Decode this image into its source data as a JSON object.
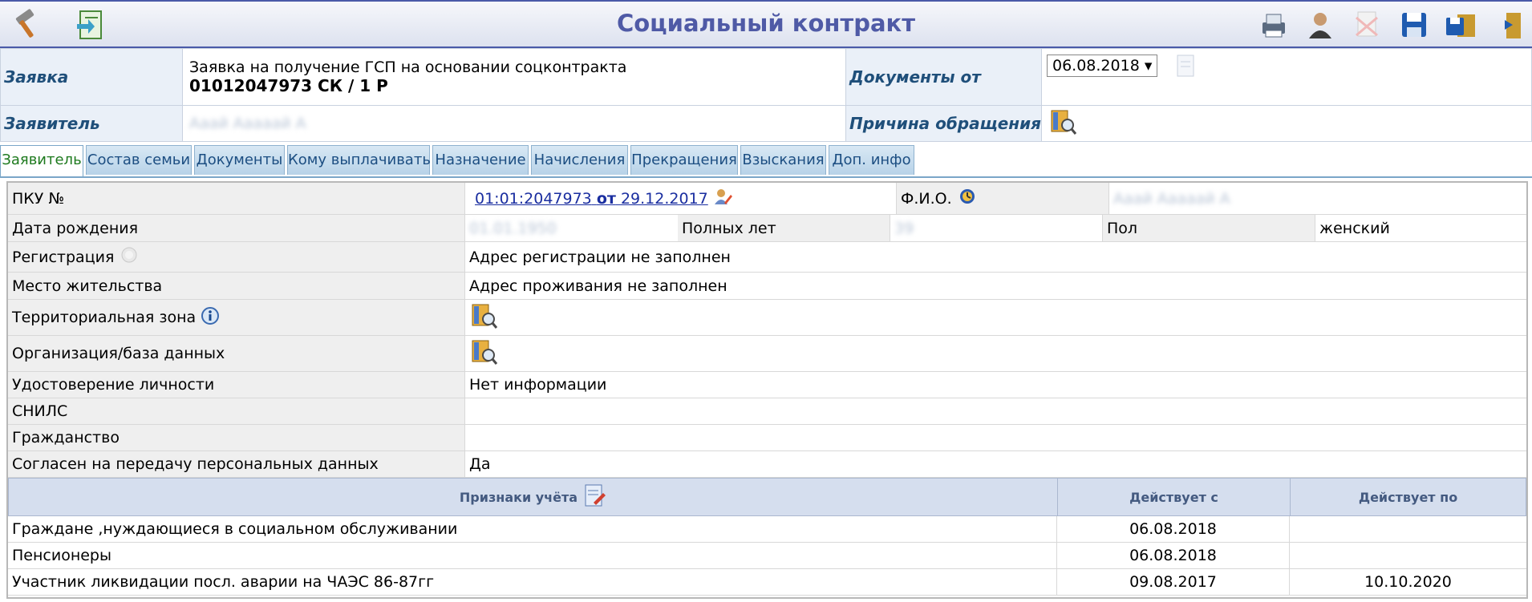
{
  "header": {
    "title": "Социальный контракт"
  },
  "request": {
    "label": "Заявка",
    "line1": "Заявка на получение ГСП на основании соцконтракта",
    "line2": "01012047973 СК / 1 Р",
    "docs_label": "Документы от",
    "docs_date": "06.08.2018",
    "applicant_label": "Заявитель",
    "applicant_value": "Ааай Ааааай А",
    "reason_label": "Причина обращения"
  },
  "tabs": [
    {
      "label": "Заявитель"
    },
    {
      "label": "Состав семьи"
    },
    {
      "label": "Документы"
    },
    {
      "label": "Кому выплачивать"
    },
    {
      "label": "Назначение"
    },
    {
      "label": "Начисления"
    },
    {
      "label": "Прекращения"
    },
    {
      "label": "Взыскания"
    },
    {
      "label": "Доп. инфо"
    }
  ],
  "details": {
    "pku_label": "ПКУ №",
    "pku_number": "01:01:2047973",
    "pku_from": "от",
    "pku_date": "29.12.2017",
    "fio_label": "Ф.И.О.",
    "fio_value": "Ааай Ааааай А",
    "birth_label": "Дата рождения",
    "birth_value": "01.01.1950",
    "age_label": "Полных лет",
    "age_value": "39",
    "sex_label": "Пол",
    "sex_value": "женский",
    "registration_label": "Регистрация",
    "registration_value": "Адрес регистрации не заполнен",
    "residence_label": "Место жительства",
    "residence_value": "Адрес проживания не заполнен",
    "zone_label": "Территориальная зона",
    "org_label": "Организация/база данных",
    "id_label": "Удостоверение личности",
    "id_value": "Нет информации",
    "snils_label": "СНИЛС",
    "citizenship_label": "Гражданство",
    "consent_label": "Согласен на передачу персональных данных",
    "consent_value": "Да"
  },
  "signs": {
    "col1": "Признаки учёта",
    "col2": "Действует с",
    "col3": "Действует по",
    "rows": [
      {
        "name": "Граждане ,нуждающиеся в социальном обслуживании",
        "from": "06.08.2018",
        "to": ""
      },
      {
        "name": "Пенсионеры",
        "from": "06.08.2018",
        "to": ""
      },
      {
        "name": "Участник ликвидации посл. аварии на ЧАЭС 86-87гг",
        "from": "09.08.2017",
        "to": "10.10.2020"
      }
    ]
  }
}
